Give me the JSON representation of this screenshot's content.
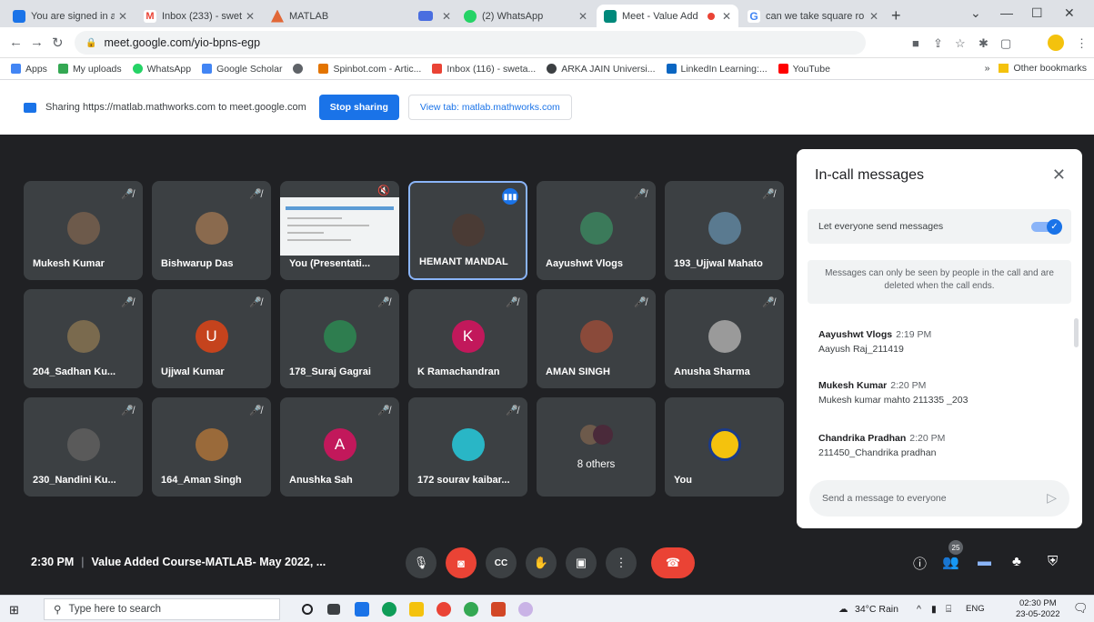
{
  "browser": {
    "tabs": [
      {
        "title": "You are signed in as 1",
        "icon": "s-icon",
        "color": "#1a73e8",
        "active": false
      },
      {
        "title": "Inbox (233) - sweta.b",
        "icon": "gmail-icon",
        "color": "#ea4335",
        "active": false
      },
      {
        "title": "MATLAB",
        "icon": "matlab-icon",
        "color": "#e16737",
        "active": false
      },
      {
        "title": "",
        "icon": "screen-icon",
        "color": "#4a6ee0",
        "active": false
      },
      {
        "title": "(2) WhatsApp",
        "icon": "whatsapp-icon",
        "color": "#25d366",
        "active": false
      },
      {
        "title": "Meet - Value Add",
        "icon": "meet-icon",
        "color": "#00897b",
        "active": true
      },
      {
        "title": "can we take square ro",
        "icon": "google-icon",
        "color": "#4285f4",
        "active": false
      }
    ],
    "url": "meet.google.com/yio-bpns-egp",
    "bookmarks": [
      {
        "label": "Apps",
        "color": "#4285f4"
      },
      {
        "label": "My uploads",
        "color": "#34a853"
      },
      {
        "label": "WhatsApp",
        "color": "#25d366"
      },
      {
        "label": "Google Scholar",
        "color": "#4285f4"
      },
      {
        "label": "",
        "color": "#5f6368"
      },
      {
        "label": "Spinbot.com - Artic...",
        "color": "#e37400"
      },
      {
        "label": "Inbox (116) - sweta...",
        "color": "#ea4335"
      },
      {
        "label": "ARKA JAIN Universi...",
        "color": "#3c4043"
      },
      {
        "label": "LinkedIn Learning:...",
        "color": "#0a66c2"
      },
      {
        "label": "YouTube",
        "color": "#ff0000"
      }
    ],
    "other_bookmarks": "Other bookmarks"
  },
  "sharebar": {
    "text": "Sharing https://matlab.mathworks.com to meet.google.com",
    "stop_label": "Stop sharing",
    "view_label": "View tab: matlab.mathworks.com"
  },
  "participants": [
    {
      "name": "Mukesh Kumar",
      "avatar": "photo",
      "color": "#6d5a4b"
    },
    {
      "name": "Bishwarup Das",
      "avatar": "photo",
      "color": "#8a6a4e"
    },
    {
      "name": "You (Presentati...",
      "avatar": "presentation",
      "color": "#f1f3f4"
    },
    {
      "name": "HEMANT MANDAL",
      "avatar": "photo",
      "color": "#4a3b35"
    },
    {
      "name": "Aayushwt Vlogs",
      "avatar": "photo",
      "color": "#3b7a5a"
    },
    {
      "name": "193_Ujjwal Mahato",
      "avatar": "photo",
      "color": "#5a7a90"
    },
    {
      "name": "204_Sadhan Ku...",
      "avatar": "photo",
      "color": "#7a6a4e"
    },
    {
      "name": "Ujjwal Kumar",
      "avatar": "letter",
      "letter": "U",
      "color": "#c5431d"
    },
    {
      "name": "178_Suraj Gagrai",
      "avatar": "photo",
      "color": "#2e7d4f"
    },
    {
      "name": "K Ramachandran",
      "avatar": "letter",
      "letter": "K",
      "color": "#c2185b"
    },
    {
      "name": "AMAN SINGH",
      "avatar": "photo",
      "color": "#8a4a3a"
    },
    {
      "name": "Anusha Sharma",
      "avatar": "photo",
      "color": "#9a9a9a"
    },
    {
      "name": "230_Nandini Ku...",
      "avatar": "photo",
      "color": "#5a5a5a"
    },
    {
      "name": "164_Aman Singh",
      "avatar": "photo",
      "color": "#9a6a3a"
    },
    {
      "name": "Anushka Sah",
      "avatar": "letter",
      "letter": "A",
      "color": "#c2185b"
    },
    {
      "name": "172 sourav kaibar...",
      "avatar": "photo",
      "color": "#29b6c6"
    },
    {
      "name": "8 others",
      "avatar": "group",
      "color": "#3c4043"
    },
    {
      "name": "You",
      "avatar": "logo",
      "color": "#f4c20d"
    }
  ],
  "panel": {
    "title": "In-call messages",
    "toggle_label": "Let everyone send messages",
    "notice": "Messages can only be seen by people in the call and are deleted when the call ends.",
    "messages": [
      {
        "sender": "Aayushwt Vlogs",
        "time": "2:19 PM",
        "text": "Aayush Raj_211419"
      },
      {
        "sender": "Mukesh Kumar",
        "time": "2:20 PM",
        "text": "Mukesh kumar mahto 211335 _203"
      },
      {
        "sender": "Chandrika Pradhan",
        "time": "2:20 PM",
        "text": "211450_Chandrika pradhan"
      }
    ],
    "input_placeholder": "Send a message to everyone"
  },
  "controls": {
    "time": "2:30 PM",
    "meeting_title": "Value Added Course-MATLAB- May 2022, ...",
    "people_count": "25"
  },
  "taskbar": {
    "search_placeholder": "Type here to search",
    "weather": "34°C Rain",
    "lang": "ENG",
    "time": "02:30 PM",
    "date": "23-05-2022"
  }
}
